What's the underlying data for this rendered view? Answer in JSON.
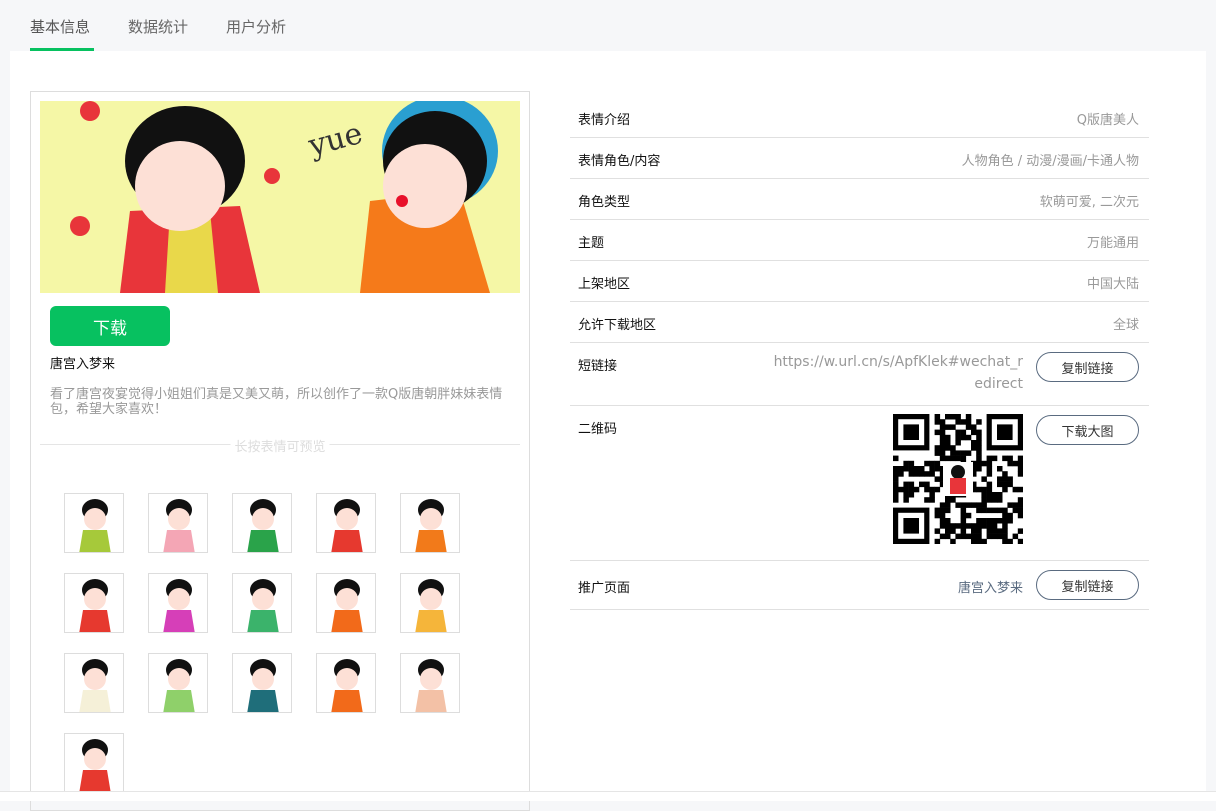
{
  "tabs": [
    {
      "label": "基本信息"
    },
    {
      "label": "数据统计"
    },
    {
      "label": "用户分析"
    }
  ],
  "left": {
    "banner_text": "yue",
    "download_label": "下载",
    "name": "唐宫入梦来",
    "description": "看了唐宫夜宴觉得小姐姐们真是又美又萌，所以创作了一款Q版唐朝胖妹妹表情包，希望大家喜欢！",
    "preview_hint": "长按表情可预览",
    "stickers": [
      {
        "color": "#a6c93a"
      },
      {
        "color": "#f4a6b5"
      },
      {
        "color": "#2aa34a"
      },
      {
        "color": "#e6392f"
      },
      {
        "color": "#f27a1a"
      },
      {
        "color": "#e6392f"
      },
      {
        "color": "#d63fb8"
      },
      {
        "color": "#3bb36b"
      },
      {
        "color": "#f26a1a"
      },
      {
        "color": "#f5b53a"
      },
      {
        "color": "#f5f0d8"
      },
      {
        "color": "#8fd06a"
      },
      {
        "color": "#1f6e7a"
      },
      {
        "color": "#f26a1a"
      },
      {
        "color": "#f3c1a6"
      },
      {
        "color": "#e6392f"
      }
    ]
  },
  "info": {
    "rows": [
      {
        "label": "表情介绍",
        "value": "Q版唐美人"
      },
      {
        "label": "表情角色/内容",
        "value": "人物角色 / 动漫/漫画/卡通人物"
      },
      {
        "label": "角色类型",
        "value": "软萌可爱, 二次元"
      },
      {
        "label": "主题",
        "value": "万能通用"
      },
      {
        "label": "上架地区",
        "value": "中国大陆"
      },
      {
        "label": "允许下载地区",
        "value": "全球"
      }
    ],
    "short_link": {
      "label": "短链接",
      "value": "https://w.url.cn/s/ApfKlek#wechat_redirect",
      "button": "复制链接"
    },
    "qr": {
      "label": "二维码",
      "button": "下载大图"
    },
    "promo": {
      "label": "推广页面",
      "value": "唐宫入梦来",
      "button": "复制链接"
    }
  },
  "colors": {
    "accent": "#07c160"
  }
}
